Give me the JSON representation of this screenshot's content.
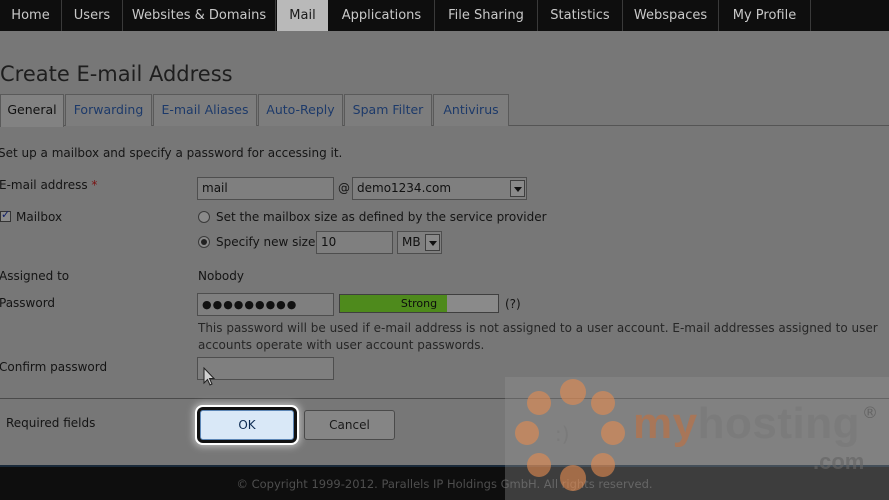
{
  "nav": {
    "items": [
      {
        "label": "Home"
      },
      {
        "label": "Users"
      },
      {
        "label": "Websites & Domains"
      },
      {
        "label": "Mail",
        "active": true
      },
      {
        "label": "Applications"
      },
      {
        "label": "File Sharing"
      },
      {
        "label": "Statistics"
      },
      {
        "label": "Webspaces"
      },
      {
        "label": "My Profile"
      }
    ]
  },
  "page": {
    "title": "Create E-mail Address"
  },
  "tabs": [
    {
      "label": "General",
      "active": true
    },
    {
      "label": "Forwarding"
    },
    {
      "label": "E-mail Aliases"
    },
    {
      "label": "Auto-Reply"
    },
    {
      "label": "Spam Filter"
    },
    {
      "label": "Antivirus"
    }
  ],
  "form": {
    "intro": "Set up a mailbox and specify a password for accessing it.",
    "email": {
      "label": "E-mail address",
      "required_mark": "*",
      "local_value": "mail",
      "at": "@",
      "domain_value": "demo1234.com"
    },
    "mailbox": {
      "label": "Mailbox",
      "checked": true,
      "option_default": "Set the mailbox size as defined by the service provider",
      "option_custom": "Specify new size",
      "size_value": "10",
      "size_unit": "MB"
    },
    "assigned": {
      "label": "Assigned to",
      "value": "Nobody"
    },
    "password": {
      "label": "Password",
      "value": "●●●●●●●●●",
      "strength_label": "Strong",
      "strength_level": 0.68,
      "help": "(?)",
      "hint": "This password will be used if e-mail address is not assigned to a user account. E-mail addresses assigned to user accounts operate with user account passwords."
    },
    "confirm": {
      "label": "Confirm password",
      "value": ""
    },
    "required_note": "Required fields",
    "ok_label": "OK",
    "cancel_label": "Cancel"
  },
  "footer": {
    "copyright": "© Copyright 1999-2012. Parallels IP Holdings GmbH. All rights reserved."
  },
  "watermark": {
    "brand_a": "my",
    "brand_b": "hosting",
    "reg": "®",
    "suffix": ".com",
    "accent": "#e68c50"
  },
  "colors": {
    "ok_button": "#d9e8f7",
    "strength_bar": "#4e8a1c",
    "nav_bg": "#0e0e0e"
  }
}
